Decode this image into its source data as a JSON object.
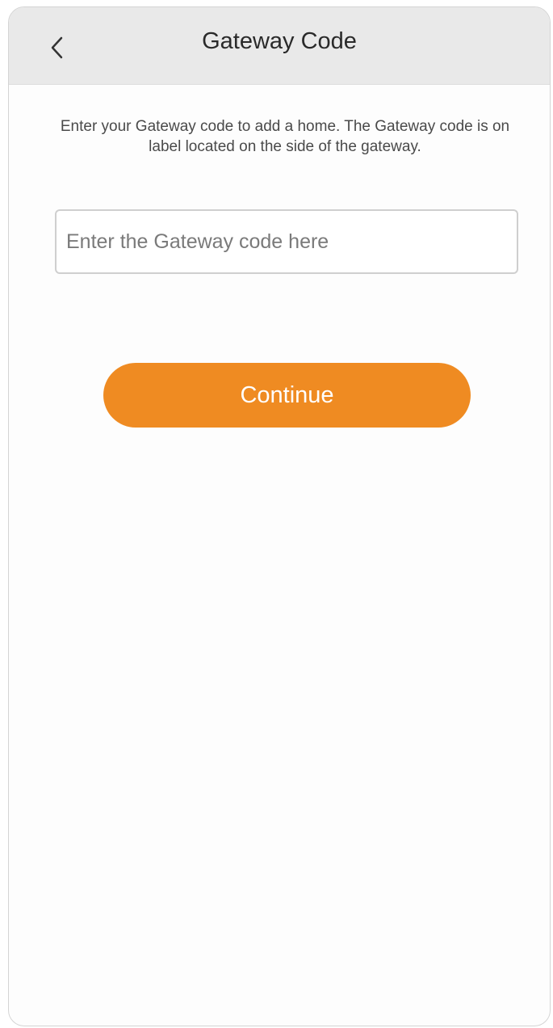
{
  "header": {
    "title": "Gateway Code",
    "back_icon": "chevron-left-icon"
  },
  "main": {
    "instructions": "Enter your Gateway code to add a home. The Gateway code is on label located on the side of the gateway.",
    "code_input": {
      "value": "",
      "placeholder": "Enter the Gateway code here"
    },
    "continue_label": "Continue"
  },
  "colors": {
    "accent": "#ef8b22",
    "header_bg": "#e9e9e9"
  }
}
